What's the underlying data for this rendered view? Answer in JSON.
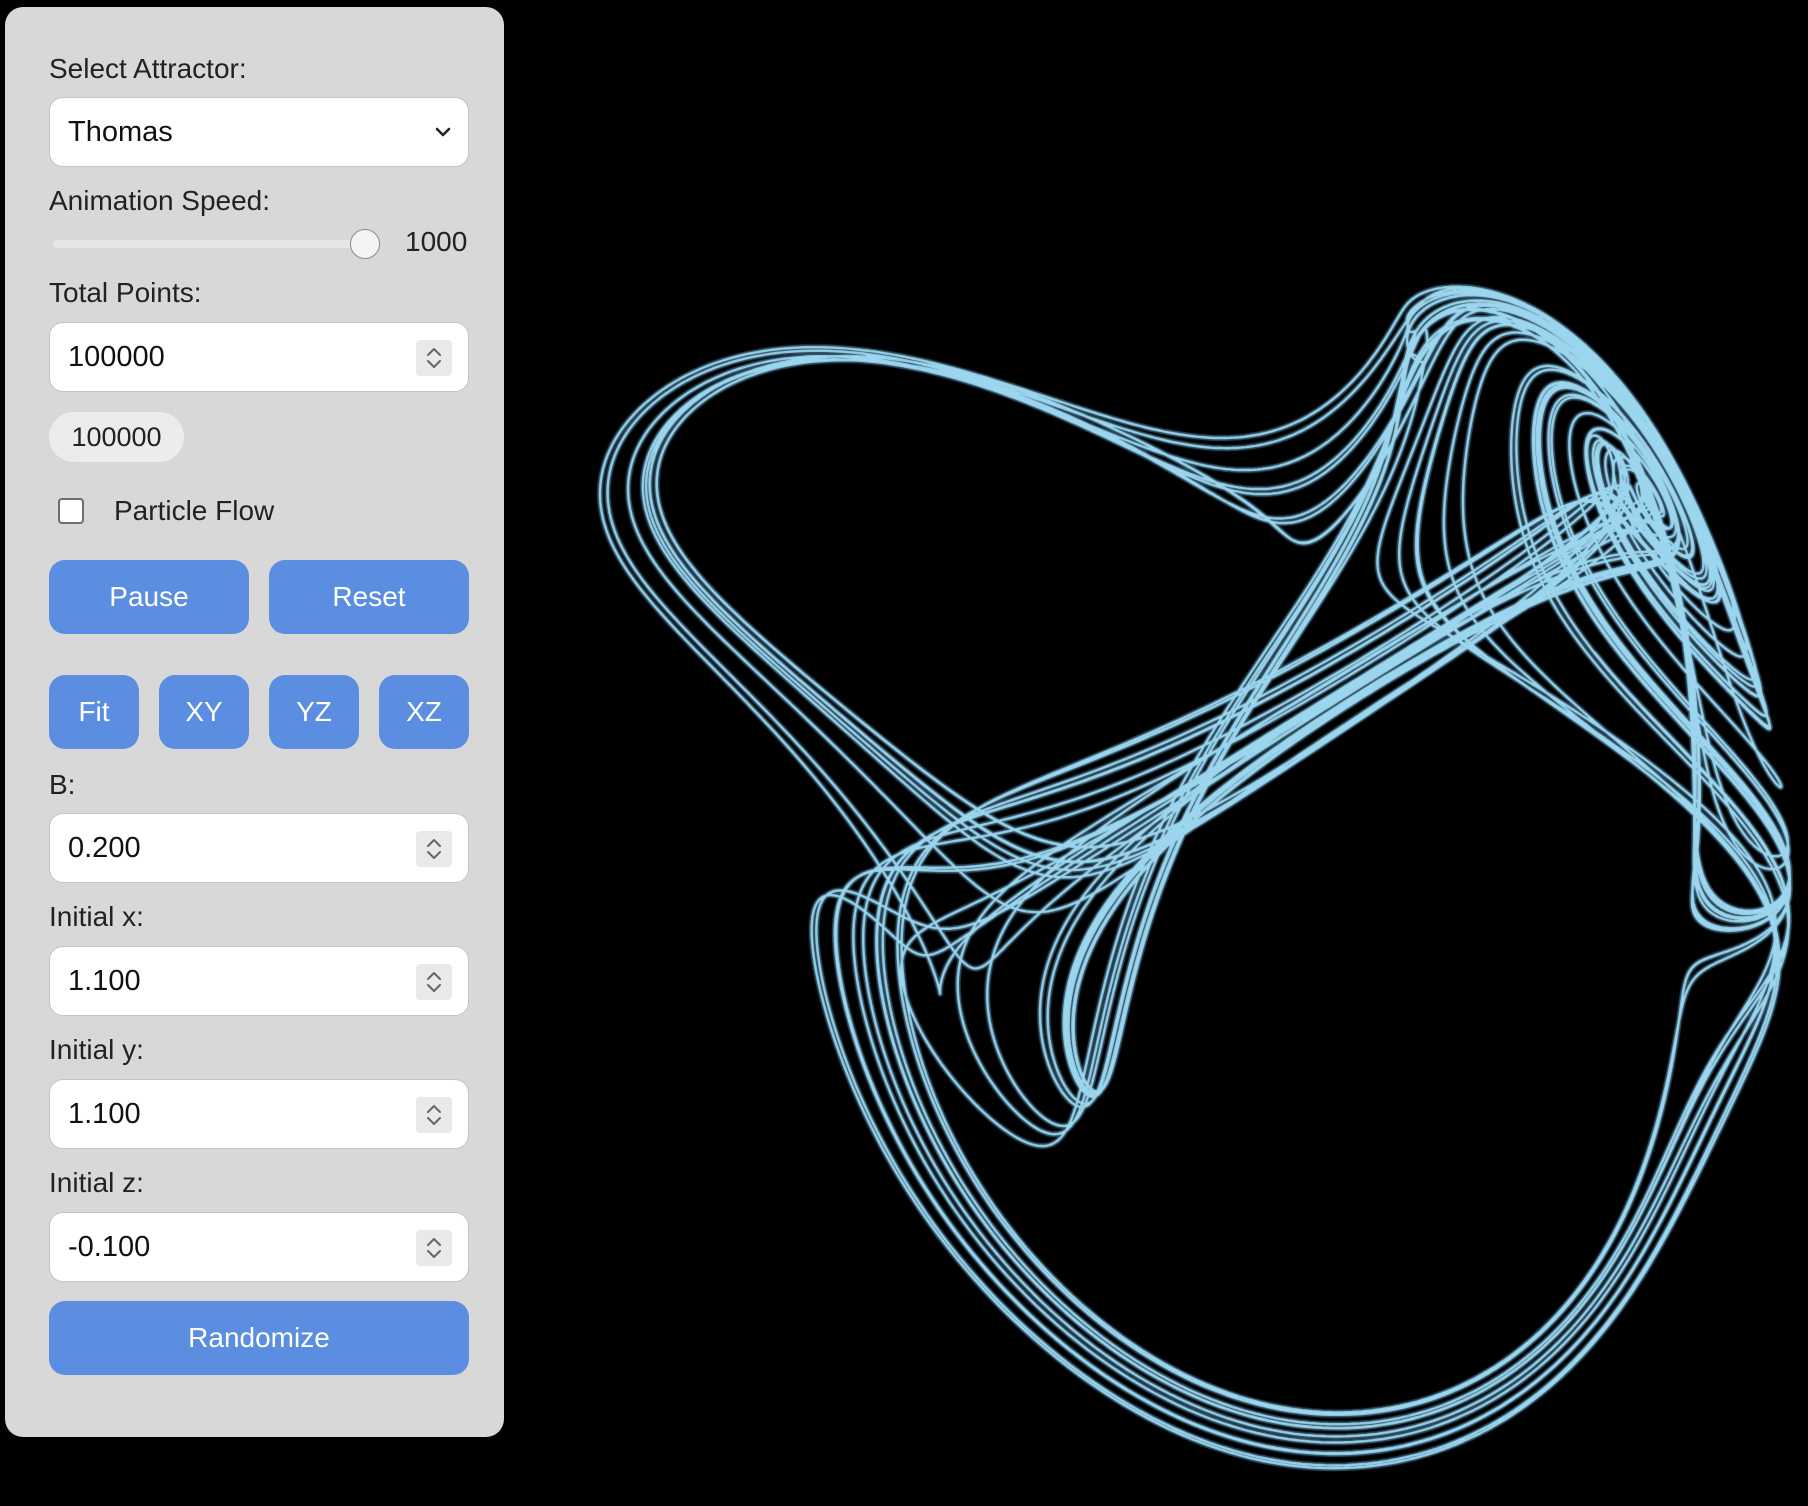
{
  "controls": {
    "attractor_label": "Select Attractor:",
    "attractor_value": "Thomas",
    "speed_label": "Animation Speed:",
    "speed_value": "1000",
    "total_points_label": "Total Points:",
    "total_points_value": "100000",
    "points_count_badge": "100000",
    "particle_flow_label": "Particle Flow",
    "particle_flow_checked": false,
    "pause_label": "Pause",
    "reset_label": "Reset",
    "view_buttons": [
      "Fit",
      "XY",
      "YZ",
      "XZ"
    ],
    "b_label": "B:",
    "b_value": "0.200",
    "initial_x_label": "Initial x:",
    "initial_x_value": "1.100",
    "initial_y_label": "Initial y:",
    "initial_y_value": "1.100",
    "initial_z_label": "Initial z:",
    "initial_z_value": "-0.100",
    "randomize_label": "Randomize"
  },
  "colors": {
    "background": "#000000",
    "panel": "#d8d8d8",
    "button": "#5b8ee0",
    "trajectory": "#a8e6ff",
    "trajectory_core": "#6fc3f5"
  }
}
